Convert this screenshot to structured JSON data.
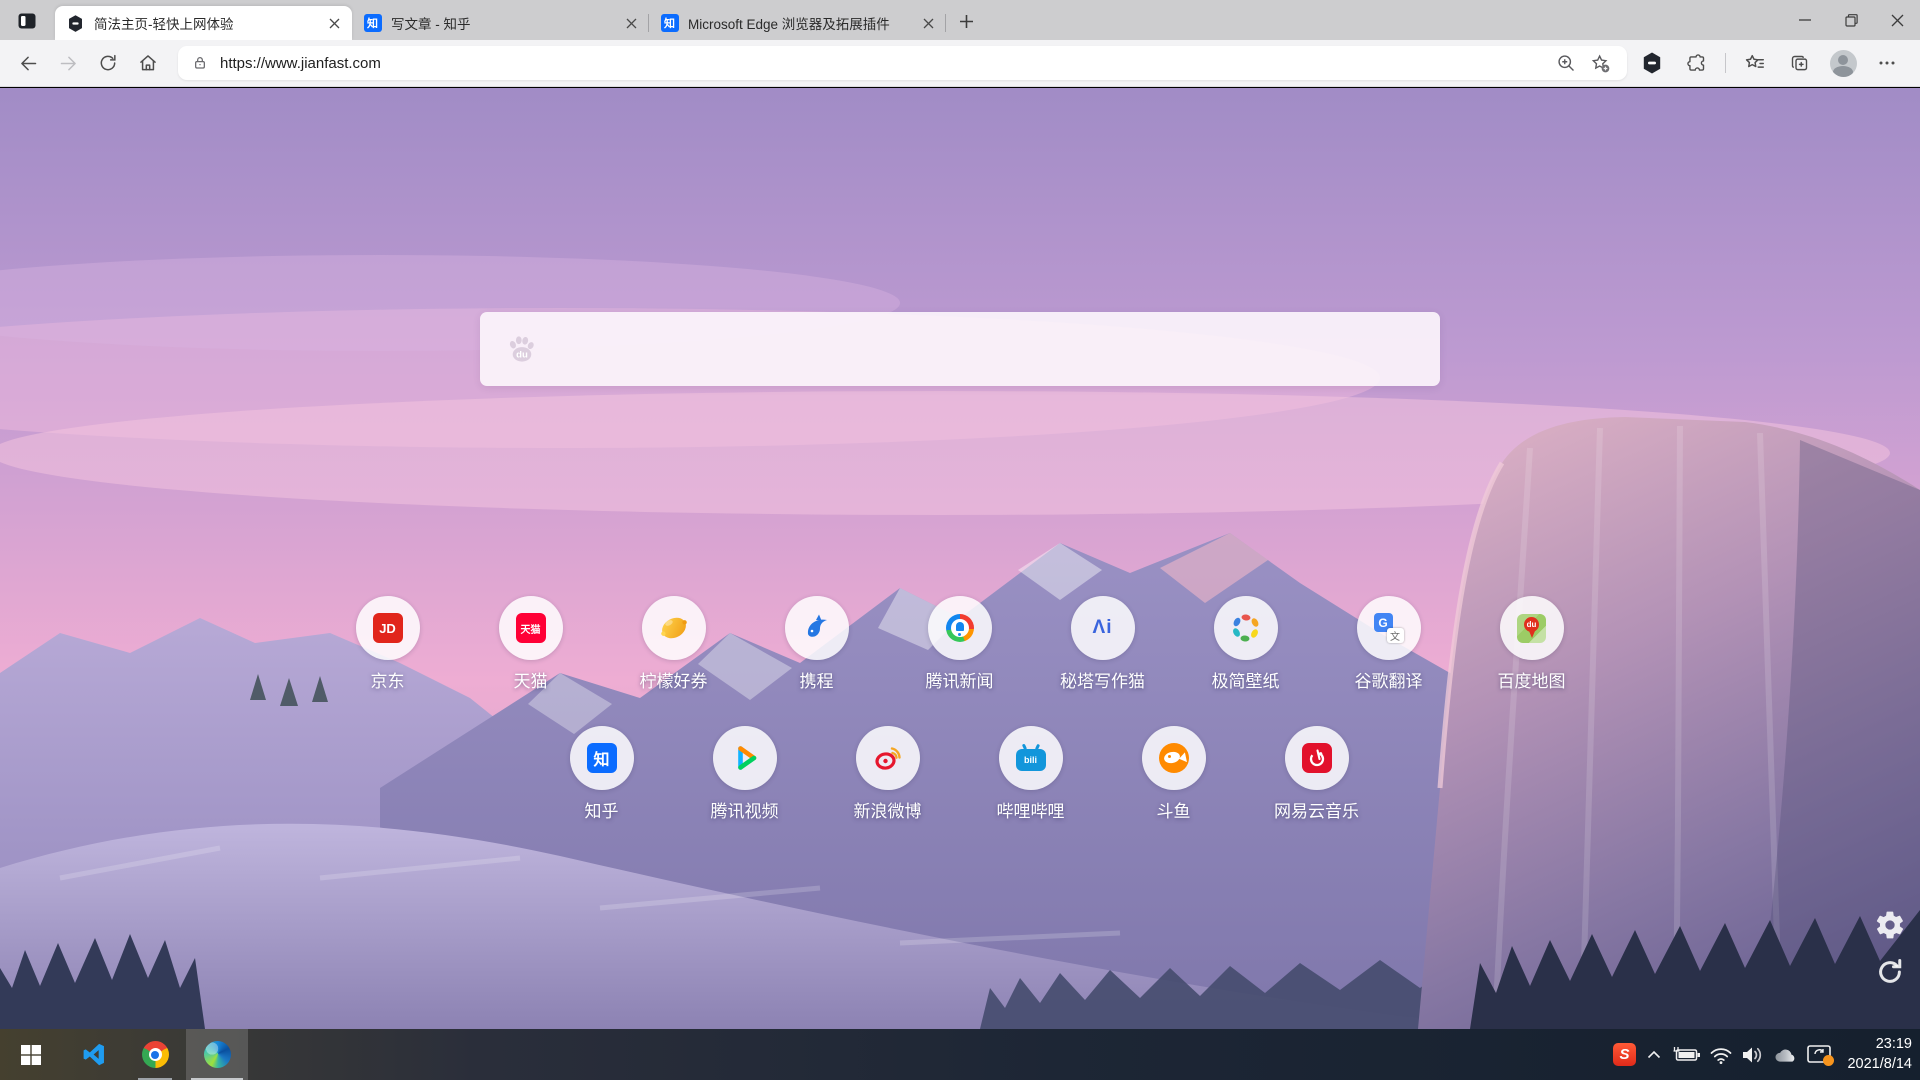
{
  "browser": {
    "tabs": [
      {
        "title": "简法主页-轻快上网体验",
        "favicon": "jianfa-logo-icon",
        "active": true
      },
      {
        "title": "写文章 - 知乎",
        "favicon": "zhihu-icon",
        "favicon_glyph": "知",
        "active": false
      },
      {
        "title": "Microsoft Edge 浏览器及拓展插件",
        "favicon": "zhihu-icon",
        "favicon_glyph": "知",
        "active": false
      }
    ],
    "url": "https://www.jianfast.com"
  },
  "page": {
    "search": {
      "engine_icon": "baidu-paw-icon",
      "glyph": "du"
    },
    "shortcut_rows": [
      [
        {
          "label": "京东",
          "icon": "jd-logo-icon",
          "glyph": "JD"
        },
        {
          "label": "天猫",
          "icon": "tmall-logo-icon",
          "glyph": "天猫"
        },
        {
          "label": "柠檬好券",
          "icon": "lemon-logo-icon"
        },
        {
          "label": "携程",
          "icon": "ctrip-logo-icon"
        },
        {
          "label": "腾讯新闻",
          "icon": "tencent-news-logo-icon"
        },
        {
          "label": "秘塔写作猫",
          "icon": "mita-logo-icon",
          "glyph": "Λi"
        },
        {
          "label": "极简壁纸",
          "icon": "jijian-wallpaper-logo-icon"
        },
        {
          "label": "谷歌翻译",
          "icon": "google-translate-logo-icon",
          "glyph": "G",
          "glyph2": "文"
        },
        {
          "label": "百度地图",
          "icon": "baidu-map-logo-icon",
          "glyph": "du"
        }
      ],
      [
        {
          "label": "知乎",
          "icon": "zhihu-logo-icon",
          "glyph": "知"
        },
        {
          "label": "腾讯视频",
          "icon": "tencent-video-logo-icon"
        },
        {
          "label": "新浪微博",
          "icon": "weibo-logo-icon"
        },
        {
          "label": "哔哩哔哩",
          "icon": "bilibili-logo-icon",
          "glyph": "bili"
        },
        {
          "label": "斗鱼",
          "icon": "douyu-logo-icon"
        },
        {
          "label": "网易云音乐",
          "icon": "netease-music-logo-icon"
        }
      ]
    ]
  },
  "taskbar": {
    "time": "23:19",
    "date": "2021/8/14",
    "sogou_glyph": "S"
  }
}
